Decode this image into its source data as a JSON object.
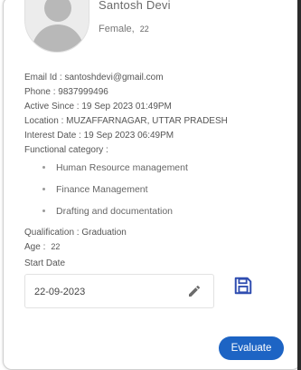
{
  "profile": {
    "name": "Santosh Devi",
    "gender": "Female,",
    "age": "22"
  },
  "details": {
    "email": "Email Id : santoshdevi@gmail.com",
    "phone": "Phone : 9837999496",
    "active_since": "Active Since : 19 Sep 2023 01:49PM",
    "location": "Location : MUZAFFARNAGAR, UTTAR PRADESH",
    "interest_date": "Interest Date : 19 Sep 2023 06:49PM",
    "functional_category_label": "Functional category :",
    "functional_categories": [
      "Human Resource management",
      "Finance Management",
      "Drafting and documentation"
    ],
    "qualification": "Qualification : Graduation",
    "age_label": "Age :",
    "age_value": "22",
    "start_date_label": "Start Date",
    "start_date_value": "22-09-2023"
  },
  "actions": {
    "evaluate_label": "Evaluate"
  },
  "colors": {
    "accent": "#1d64c4",
    "save_icon": "#2f4db0",
    "pencil_icon": "#6b6b6b"
  },
  "icons": {
    "edit": "pencil-icon",
    "save": "floppy-disk-icon",
    "avatar": "user-silhouette-icon"
  }
}
